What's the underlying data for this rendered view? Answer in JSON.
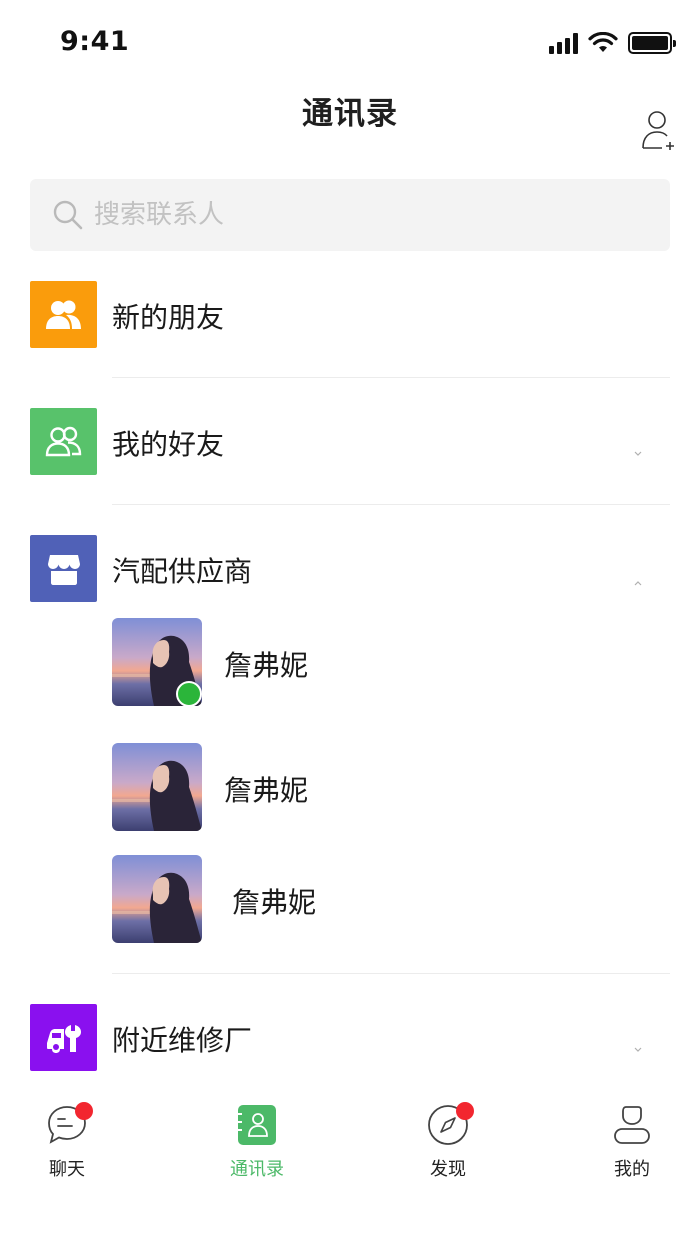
{
  "status_bar": {
    "time": "9:41"
  },
  "header": {
    "title": "通讯录",
    "add_contact_icon": "add-contact-icon"
  },
  "search": {
    "placeholder": "搜索联系人",
    "value": ""
  },
  "rows": {
    "new_friends": {
      "label": "新的朋友",
      "color": "#fa9c0c",
      "icon": "people-icon"
    },
    "my_friends": {
      "label": "我的好友",
      "color": "#58c26b",
      "icon": "people-icon",
      "expanded": false
    },
    "suppliers": {
      "label": "汽配供应商",
      "color": "#5061b7",
      "icon": "store-icon",
      "expanded": true
    },
    "repair": {
      "label": "附近维修厂",
      "color": "#8a10ef",
      "icon": "repair-icon",
      "expanded": false
    }
  },
  "supplier_members": [
    {
      "name": "詹弗妮",
      "online": true
    },
    {
      "name": "詹弗妮",
      "online": false
    },
    {
      "name": "詹弗妮",
      "online": false
    }
  ],
  "tabbar": {
    "tabs": [
      {
        "label": "聊天",
        "icon": "chat-icon",
        "badge": true,
        "active": false
      },
      {
        "label": "通讯录",
        "icon": "contacts-icon",
        "badge": false,
        "active": true
      },
      {
        "label": "发现",
        "icon": "compass-icon",
        "badge": true,
        "active": false
      },
      {
        "label": "我的",
        "icon": "profile-icon",
        "badge": false,
        "active": false
      }
    ],
    "active_color": "#4cb968",
    "badge_color": "#f2262f"
  }
}
